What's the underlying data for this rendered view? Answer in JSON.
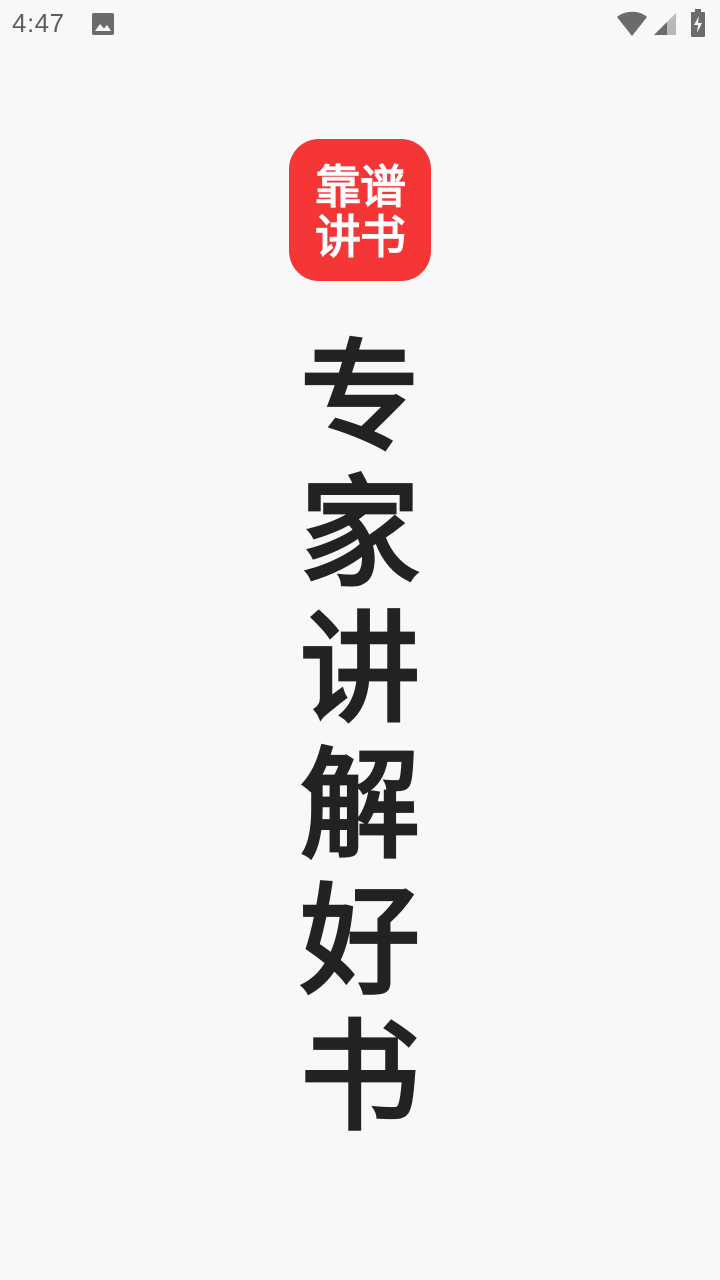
{
  "status_bar": {
    "time": "4:47",
    "icons": [
      "image-icon",
      "wifi-icon",
      "signal-icon",
      "battery-charging-icon"
    ]
  },
  "logo": {
    "line1": "靠谱",
    "line2": "讲书",
    "background_color": "#f53636",
    "text_color": "#ffffff"
  },
  "slogan": {
    "chars": [
      "专",
      "家",
      "讲",
      "解",
      "好",
      "书"
    ],
    "text_color": "#222222"
  },
  "page": {
    "background_color": "#f8f8f8"
  }
}
